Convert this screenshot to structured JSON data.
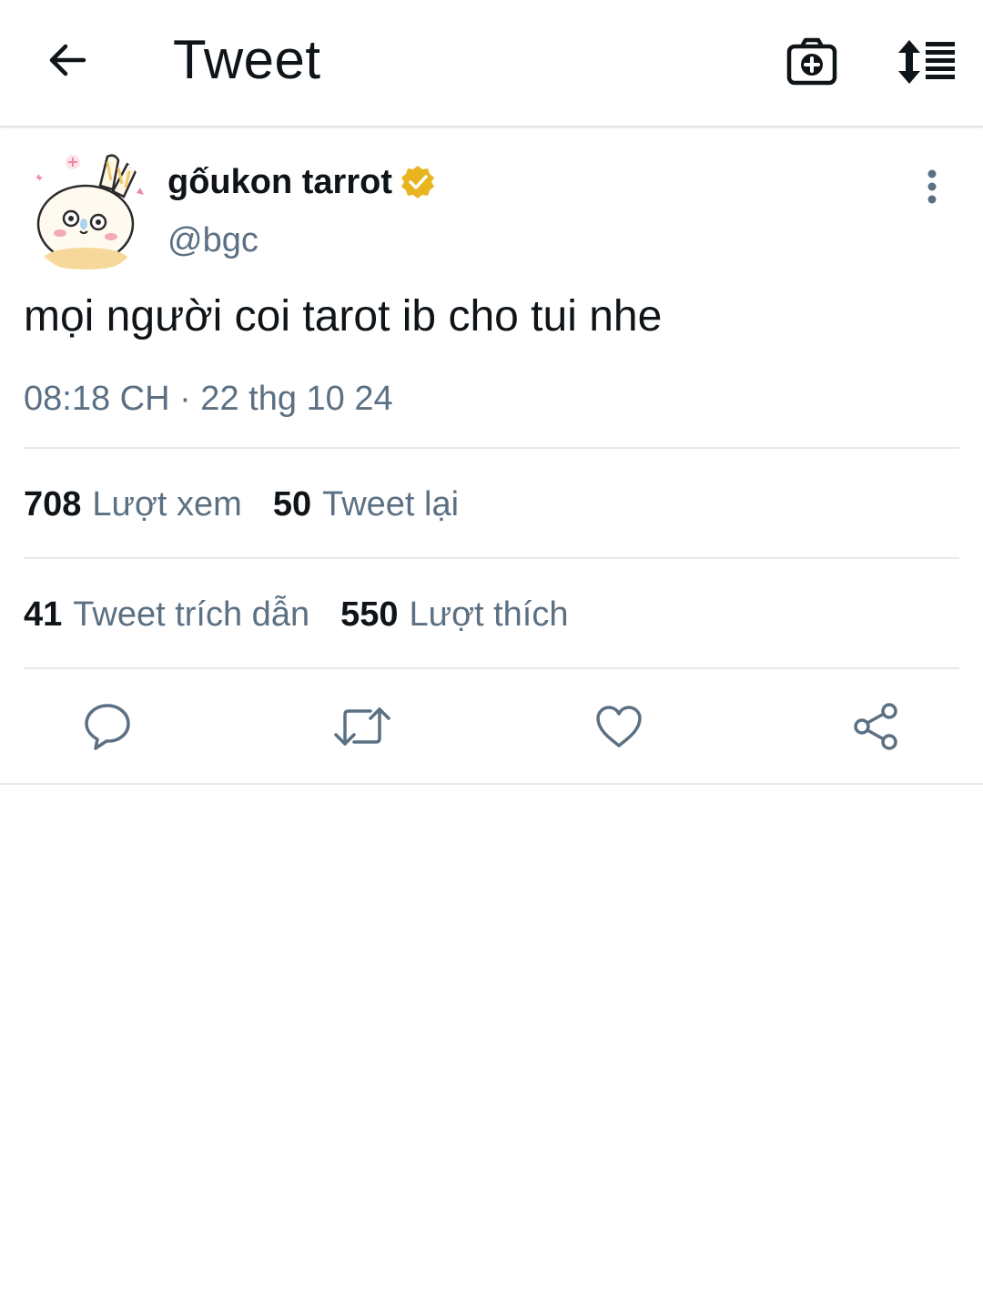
{
  "header": {
    "title": "Tweet",
    "icons": {
      "back": "arrow-left-icon",
      "camera": "camera-plus-icon",
      "sort": "sort-list-icon"
    }
  },
  "tweet": {
    "display_name": "gốukon tarrot",
    "handle": "@bgc",
    "verified_badge": "gold-verified-icon",
    "text": "mọi người coi tarot ib cho tui nhe",
    "timestamp": "08:18 CH · 22 thg 10 24"
  },
  "stats": {
    "views": {
      "count": "708",
      "label": "Lượt xem"
    },
    "retweets": {
      "count": "50",
      "label": "Tweet lại"
    },
    "quotes": {
      "count": "41",
      "label": "Tweet trích dẫn"
    },
    "likes": {
      "count": "550",
      "label": "Lượt thích"
    }
  },
  "actions": {
    "icons": [
      "reply-icon",
      "retweet-icon",
      "like-icon",
      "share-icon"
    ]
  },
  "colors": {
    "text_primary": "#0f1419",
    "text_secondary": "#5b7083",
    "divider": "#e6e9ec",
    "verified_gold": "#e8b41f",
    "action_icon": "#5b7083"
  }
}
